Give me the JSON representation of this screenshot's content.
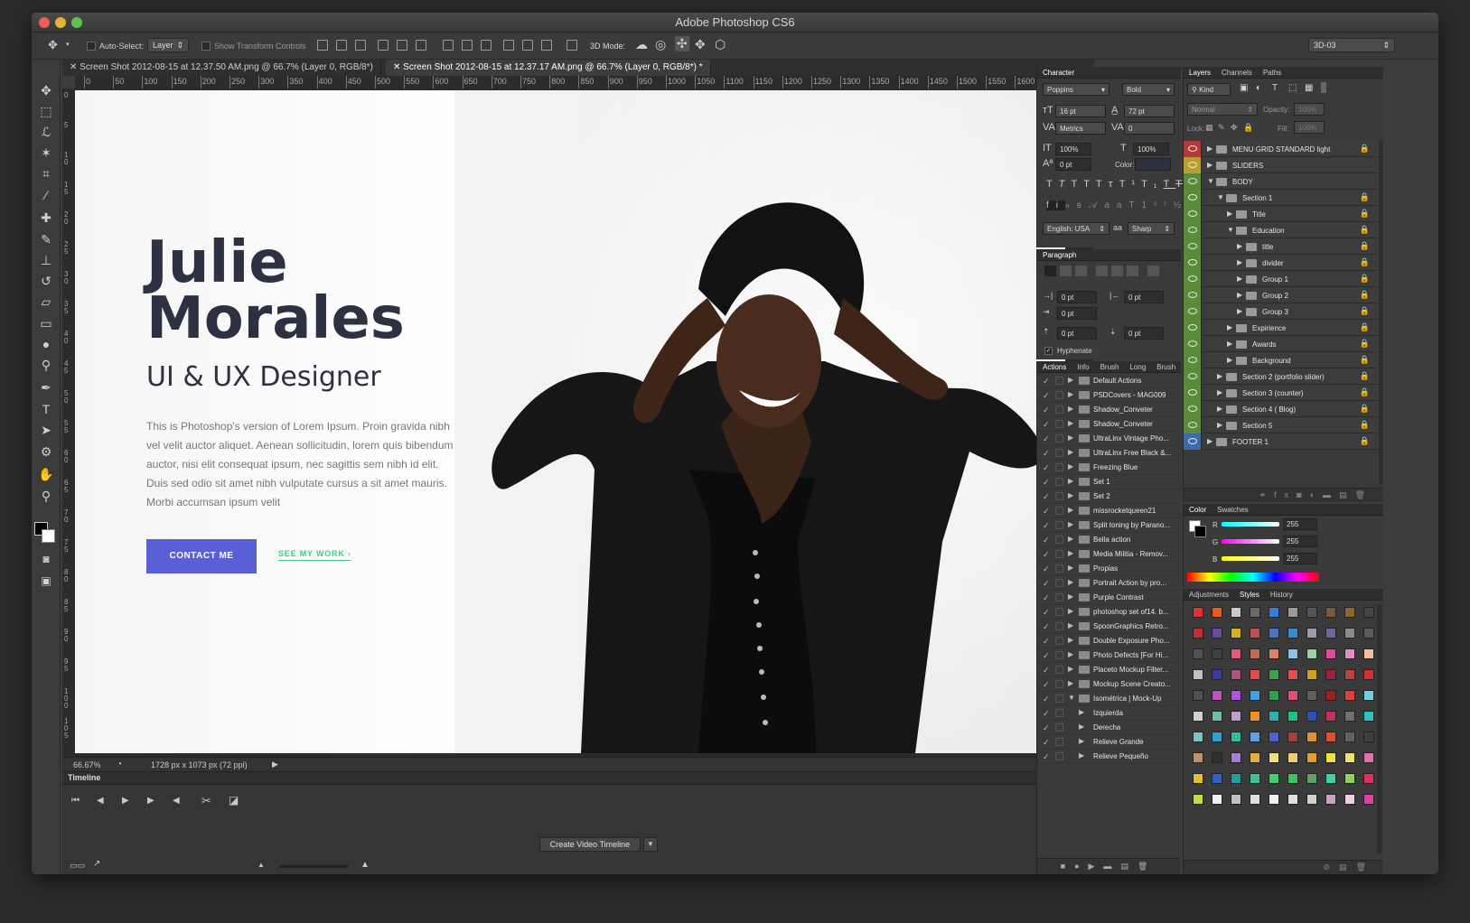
{
  "app": {
    "title": "Adobe Photoshop CS6"
  },
  "options_bar": {
    "auto_select_label": "Auto-Select:",
    "auto_select_value": "Layer",
    "show_transform_label": "Show Transform Controls",
    "mode_3d_label": "3D Mode:",
    "workspace_value": "3D-03"
  },
  "tabs": [
    {
      "label": "Screen Shot 2012-08-15 at 12.37.50 AM.png @ 66.7% (Layer 0, RGB/8*)"
    },
    {
      "label": "Screen Shot 2012-08-15 at 12.37.17 AM.png @ 66.7% (Layer 0, RGB/8*) *"
    }
  ],
  "ruler_ticks": [
    "0",
    "50",
    "100",
    "150",
    "200",
    "250",
    "300",
    "350",
    "400",
    "450",
    "500",
    "550",
    "600",
    "650",
    "700",
    "750",
    "800",
    "850",
    "900",
    "950",
    "1000",
    "1050",
    "1100",
    "1150",
    "1200",
    "1250",
    "1300",
    "1350",
    "1400",
    "1450",
    "1500",
    "1550",
    "1600",
    "1650",
    "1700"
  ],
  "ruler_v_ticks": [
    "0",
    "5",
    "1 0",
    "1 5",
    "2 0",
    "2 5",
    "3 0",
    "3 5",
    "4 0",
    "4 5",
    "5 0",
    "5 5",
    "6 0",
    "6 5",
    "7 0",
    "7 5",
    "8 0",
    "8 5",
    "9 0",
    "9 5",
    "1 0 0",
    "1 0 5"
  ],
  "artboard": {
    "name_line1": "Julie",
    "name_line2": "Morales",
    "role": "UI & UX Designer",
    "bio": "This is Photoshop's version  of Lorem Ipsum. Proin gravida nibh vel velit auctor aliquet. Aenean sollicitudin, lorem quis bibendum auctor, nisi elit consequat ipsum, nec sagittis sem nibh id elit. Duis sed odio sit amet nibh vulputate cursus a sit amet mauris. Morbi accumsan ipsum velit",
    "cta_primary": "CONTACT ME",
    "cta_secondary": "SEE MY WORK",
    "cta_secondary_arrow": "›"
  },
  "status": {
    "zoom": "66.67%",
    "doc_size": "1728 px x 1073 px (72 ppi)"
  },
  "timeline": {
    "title": "Timeline",
    "create_button": "Create Video Timeline"
  },
  "character": {
    "tab": "Character",
    "font": "Poppins",
    "style": "Bold",
    "size": "16 pt",
    "leading": "72 pt",
    "kerning": "Metrics",
    "tracking": "0",
    "vscale": "100%",
    "hscale": "100%",
    "baseline": "0 pt",
    "color_label": "Color:",
    "language": "English: USA",
    "antialias": "Sharp"
  },
  "paragraph": {
    "tab": "Paragraph",
    "indent_left": "0 pt",
    "indent_right": "0 pt",
    "indent_first": "0 pt",
    "space_before": "0 pt",
    "space_after": "0 pt",
    "hyphenate": "Hyphenate"
  },
  "actions": {
    "tabs": [
      "Actions",
      "Info",
      "Brush",
      "Long",
      "Brush"
    ],
    "items": [
      {
        "label": "Default Actions",
        "level": 0
      },
      {
        "label": "PSDCovers - MAG009",
        "level": 0
      },
      {
        "label": "Shadow_Conveter",
        "level": 0
      },
      {
        "label": "Shadow_Conveter",
        "level": 0
      },
      {
        "label": "UltraLinx Vintage Pho...",
        "level": 0
      },
      {
        "label": "UltraLinx Free Black &...",
        "level": 0
      },
      {
        "label": "Freezing Blue",
        "level": 0
      },
      {
        "label": "Set 1",
        "level": 0
      },
      {
        "label": "Set 2",
        "level": 0
      },
      {
        "label": "missrocketqueen21",
        "level": 0
      },
      {
        "label": "Split toning by Parano...",
        "level": 0
      },
      {
        "label": "Bella action",
        "level": 0
      },
      {
        "label": "Media Militia - Remov...",
        "level": 0
      },
      {
        "label": "Propias",
        "level": 0
      },
      {
        "label": "Portrait Action by pro...",
        "level": 0
      },
      {
        "label": "Purple Contrast",
        "level": 0
      },
      {
        "label": "photoshop set of14. b...",
        "level": 0
      },
      {
        "label": "SpoonGraphics Retro...",
        "level": 0
      },
      {
        "label": "Double Exposure Pho...",
        "level": 0
      },
      {
        "label": "Photo Defects [For Hi...",
        "level": 0
      },
      {
        "label": "Placeto Mockup Filter...",
        "level": 0
      },
      {
        "label": "Mockup Scene Creato...",
        "level": 0
      },
      {
        "label": "Isométrica | Mock-Up",
        "level": 0,
        "open": true
      },
      {
        "label": "Izquierda",
        "level": 1
      },
      {
        "label": "Derecha",
        "level": 1
      },
      {
        "label": "Relieve Grande",
        "level": 1
      },
      {
        "label": "Relieve Pequeño",
        "level": 1
      }
    ]
  },
  "layers": {
    "tabs": [
      "Layers",
      "Channels",
      "Paths"
    ],
    "kind": "Kind",
    "blend": "Normal",
    "opacity_label": "Opacity:",
    "opacity": "100%",
    "lock_label": "Lock:",
    "fill_label": "Fill:",
    "fill": "100%",
    "items": [
      {
        "label": "MENU GRID STANDARD light",
        "level": 0,
        "eye": "#b23a3a",
        "lock": true
      },
      {
        "label": "SLIDERS",
        "level": 0,
        "eye": "#b8a030",
        "lock": false
      },
      {
        "label": "BODY",
        "level": 0,
        "eye": "#5a8a3c",
        "open": true,
        "lock": false
      },
      {
        "label": "Section 1",
        "level": 1,
        "eye": "#5a8a3c",
        "open": true,
        "lock": true
      },
      {
        "label": "Title",
        "level": 2,
        "eye": "#5a8a3c",
        "lock": true
      },
      {
        "label": "Education",
        "level": 2,
        "eye": "#5a8a3c",
        "open": true,
        "lock": true
      },
      {
        "label": "title",
        "level": 3,
        "eye": "#5a8a3c",
        "lock": true
      },
      {
        "label": "divider",
        "level": 3,
        "eye": "#5a8a3c",
        "lock": true
      },
      {
        "label": "Group 1",
        "level": 3,
        "eye": "#5a8a3c",
        "lock": true
      },
      {
        "label": "Group 2",
        "level": 3,
        "eye": "#5a8a3c",
        "lock": true
      },
      {
        "label": "Group 3",
        "level": 3,
        "eye": "#5a8a3c",
        "lock": true
      },
      {
        "label": "Expirience",
        "level": 2,
        "eye": "#5a8a3c",
        "lock": true
      },
      {
        "label": "Awards",
        "level": 2,
        "eye": "#5a8a3c",
        "lock": true
      },
      {
        "label": "Background",
        "level": 2,
        "eye": "#5a8a3c",
        "lock": true
      },
      {
        "label": "Section 2 (portfolio slider)",
        "level": 1,
        "eye": "#5a8a3c",
        "lock": true
      },
      {
        "label": "Section 3 (counter)",
        "level": 1,
        "eye": "#5a8a3c",
        "lock": true
      },
      {
        "label": "Section 4 ( Blog)",
        "level": 1,
        "eye": "#5a8a3c",
        "lock": true
      },
      {
        "label": "Section 5",
        "level": 1,
        "eye": "#5a8a3c",
        "lock": true
      },
      {
        "label": "FOOTER 1",
        "level": 0,
        "eye": "#3e6aa8",
        "lock": true
      }
    ]
  },
  "color_panel": {
    "tabs": [
      "Color",
      "Swatches"
    ],
    "r_label": "R",
    "g_label": "G",
    "b_label": "B",
    "r": "255",
    "g": "255",
    "b": "255"
  },
  "styles_panel": {
    "tabs": [
      "Adjustments",
      "Styles",
      "History"
    ],
    "swatches": [
      "#d33",
      "#e85a1e",
      "#c9c9c9",
      "#6a6a6a",
      "#3a7bd5",
      "#9a9a9a",
      "#555",
      "#7a5a3a",
      "#8a6a2a",
      "#444",
      "#c03030",
      "#6a4aa0",
      "#d8b020",
      "#c05050",
      "#5070c0",
      "#3a8ad0",
      "#9a9aa8",
      "#6a6a9a",
      "#8a8a8a",
      "#5a5a5a",
      "#505050",
      "#404040",
      "#e05a7a",
      "#c06a5a",
      "#e0806a",
      "#90c0e0",
      "#a0d0a0",
      "#e04a9a",
      "#e090c0",
      "#f0c0a0",
      "#c0c0c0",
      "#3a3a9a",
      "#b05080",
      "#e04a4a",
      "#40a050",
      "#e05050",
      "#d0a020",
      "#a02040",
      "#c04040",
      "#d03030",
      "#505050",
      "#c050c0",
      "#b050e0",
      "#40a0e0",
      "#30a050",
      "#e05070",
      "#606060",
      "#a02020",
      "#e04040",
      "#70d0e0",
      "#d0d0d0",
      "#70c0a0",
      "#c0a0d0",
      "#f09020",
      "#30b0b0",
      "#20c080",
      "#3050c0",
      "#c03060",
      "#707070",
      "#30c0c0",
      "#80c0c0",
      "#30a0d0",
      "#30c0a0",
      "#60a0e0",
      "#5060d0",
      "#a04040",
      "#e09030",
      "#e05030",
      "#606060",
      "#404040",
      "#c09070",
      "#303030",
      "#a080d0",
      "#e0b040",
      "#f0e080",
      "#f0d070",
      "#e0a030",
      "#f0e040",
      "#f0e070",
      "#e070b0",
      "#e0c030",
      "#3060c0",
      "#20a0a0",
      "#40c090",
      "#40d070",
      "#40c060",
      "#60a060",
      "#40d0a0",
      "#90d060",
      "#e03060",
      "#c0e040",
      "#f0f0f0",
      "#c0c0c0",
      "#e0e0e0",
      "#f0f0f0",
      "#e0e0e0",
      "#d0d0d0",
      "#d0a0c0",
      "#f0d0e0",
      "#e040a0"
    ]
  }
}
